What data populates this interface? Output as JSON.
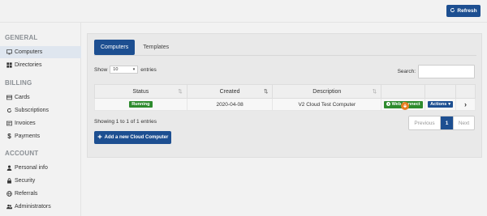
{
  "topbar": {
    "refresh_label": "Refresh",
    "refresh_icon": "refresh-icon"
  },
  "sidebar": {
    "sections": [
      {
        "title": "GENERAL",
        "items": [
          {
            "label": "Computers",
            "icon": "monitor-icon",
            "active": true
          },
          {
            "label": "Directories",
            "icon": "windows-icon",
            "active": false
          }
        ]
      },
      {
        "title": "BILLING",
        "items": [
          {
            "label": "Cards",
            "icon": "card-icon",
            "active": false
          },
          {
            "label": "Subscriptions",
            "icon": "cycle-icon",
            "active": false
          },
          {
            "label": "Invoices",
            "icon": "invoice-icon",
            "active": false
          },
          {
            "label": "Payments",
            "icon": "dollar-icon",
            "active": false
          }
        ]
      },
      {
        "title": "ACCOUNT",
        "items": [
          {
            "label": "Personal info",
            "icon": "person-icon",
            "active": false
          },
          {
            "label": "Security",
            "icon": "lock-icon",
            "active": false
          },
          {
            "label": "Referrals",
            "icon": "globe-icon",
            "active": false
          },
          {
            "label": "Administrators",
            "icon": "users-icon",
            "active": false
          }
        ]
      }
    ]
  },
  "main": {
    "tabs": [
      {
        "label": "Computers",
        "active": true
      },
      {
        "label": "Templates",
        "active": false
      }
    ],
    "show_label": "Show",
    "entries_select_value": "10",
    "entries_label": "entries",
    "search_label": "Search:",
    "table": {
      "headers": [
        "Status",
        "Created",
        "Description",
        "",
        "",
        ""
      ],
      "rows": [
        {
          "status": "Running",
          "created": "2020-04-08",
          "description": "V2 Cloud Test Computer",
          "webconnect": "Web Connect",
          "actions": "Actions"
        }
      ]
    },
    "info": "Showing 1 to 1 of 1 entries",
    "pager": {
      "prev": "Previous",
      "page": "1",
      "next": "Next"
    },
    "add_button": "Add a new Cloud Computer"
  },
  "colors": {
    "primary": "#1d4f91",
    "success": "#2e8b2e",
    "warning": "#e67e22"
  }
}
